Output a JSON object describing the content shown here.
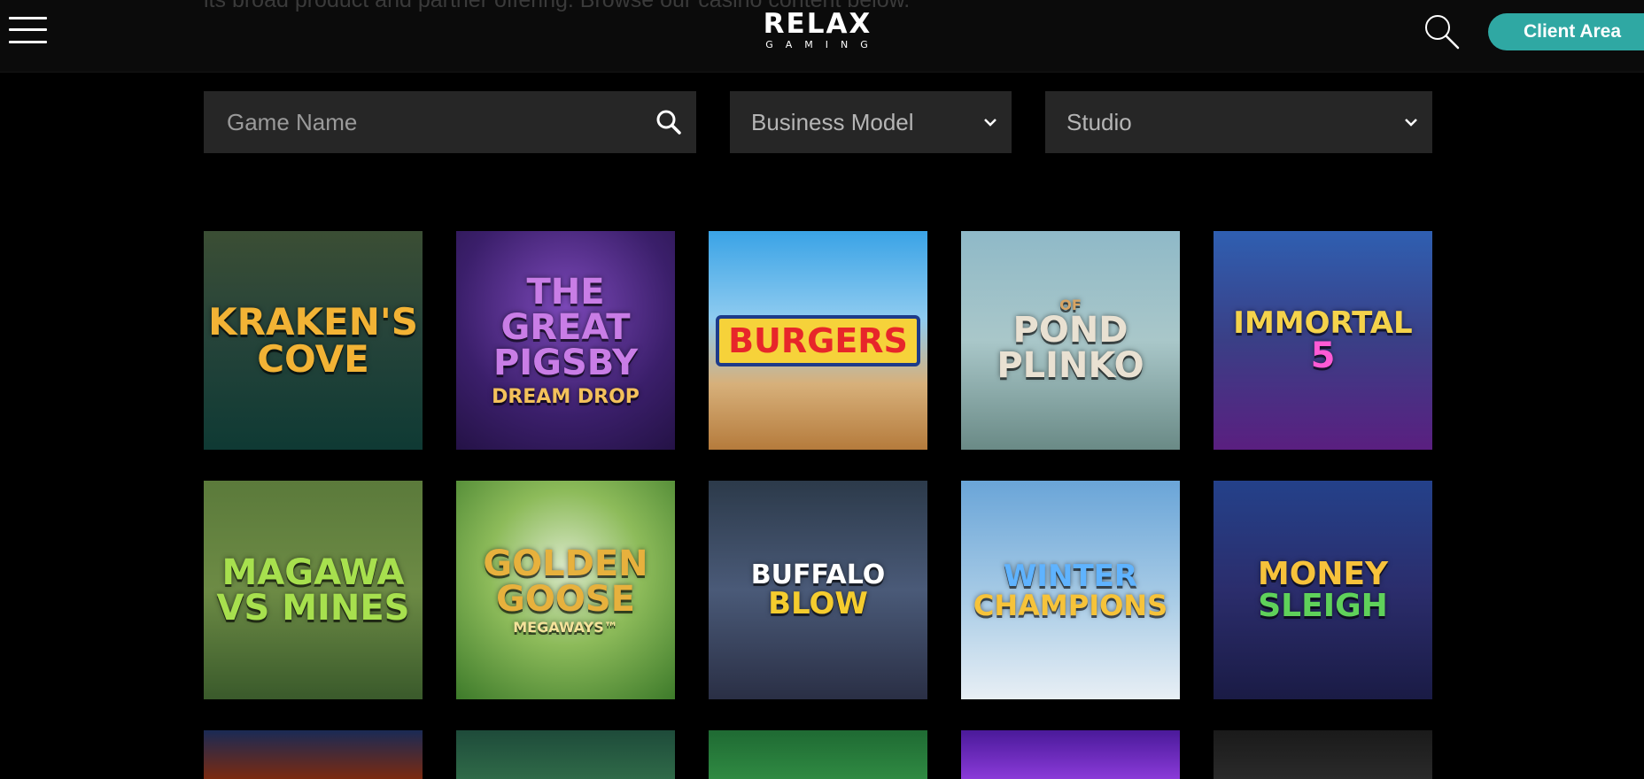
{
  "header": {
    "behind_text": "its broad product and partner offering. Browse our casino content below.",
    "logo": {
      "main": "RELAX",
      "sub": "GAMING"
    },
    "client_area_label": "Client Area"
  },
  "filters": {
    "game_name_placeholder": "Game Name",
    "business_model_label": "Business Model",
    "studio_label": "Studio"
  },
  "games": [
    {
      "title": "KRAKEN'S COVE",
      "sub": ""
    },
    {
      "title": "THE GREAT PIGSBY",
      "sub": "DREAM DROP"
    },
    {
      "title": "BURGERS",
      "sub": ""
    },
    {
      "title": "POND PLINKO",
      "sub": "OF"
    },
    {
      "title": "IMMORTAL",
      "sub": "5"
    },
    {
      "title": "MAGAWA VS MINES",
      "sub": ""
    },
    {
      "title": "GOLDEN GOOSE",
      "sub": "MEGAWAYS™"
    },
    {
      "title": "BUFFALO",
      "sub": "BLOW"
    },
    {
      "title": "WINTER",
      "sub": "CHAMPIONS"
    },
    {
      "title": "MONEY",
      "sub": "SLEIGH"
    }
  ],
  "colors": {
    "accent": "#2fa8a3",
    "background": "#000000",
    "filter_bg": "#262626"
  },
  "icons": [
    "menu-icon",
    "search-icon",
    "chevron-down-icon"
  ]
}
